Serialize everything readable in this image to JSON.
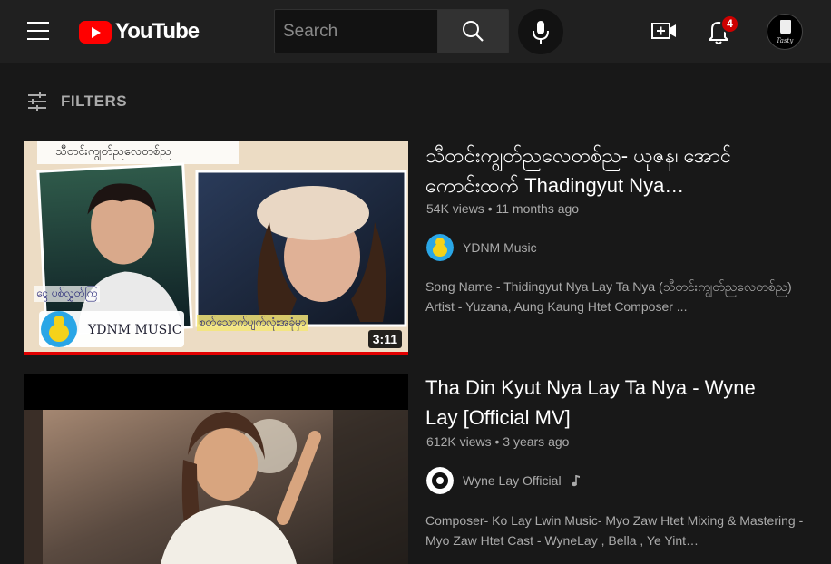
{
  "header": {
    "logo_text": "YouTube",
    "search_placeholder": "Search",
    "notification_count": "4",
    "avatar_text": "Tasty"
  },
  "filters": {
    "label": "FILTERS"
  },
  "videos": [
    {
      "thumb_caption": "သီတင်းကျွတ်ညလေတစ်ည",
      "thumb_left_text": "ငွေ ပစ်လွှတ်ကြ",
      "thumb_right_text": "စတ်သောက်ပျက်လုံးအခုံမှာ",
      "thumb_brand": "YDNM MUSIC",
      "duration": "3:11",
      "title": "သီတင်းကျွတ်ညလေတစ်ည- ယုဇန၊ အောင်ကောင်းထက် Thadingyut Nya…",
      "meta": "54K views • 11 months ago",
      "channel": "YDNM Music",
      "description": "Song Name - Thidingyut Nya Lay Ta Nya (သီတင်းကျွတ်ညလေတစ်ည) Artist - Yuzana, Aung Kaung Htet Composer ..."
    },
    {
      "title": "Tha Din Kyut Nya Lay Ta Nya - Wyne Lay [Official MV]",
      "meta": "612K views • 3 years ago",
      "channel": "Wyne Lay Official",
      "description": "Composer- Ko Lay Lwin Music- Myo Zaw Htet Mixing & Mastering - Myo Zaw Htet Cast - WyneLay , Bella , Ye Yint…"
    }
  ],
  "icons": [
    "menu-icon",
    "search-icon",
    "mic-icon",
    "create-video-icon",
    "bell-icon",
    "filter-icon",
    "music-note-icon"
  ],
  "colors": {
    "brand_red": "#ff0000",
    "badge_red": "#cc0000",
    "progress_red": "#e10000",
    "background": "#181818",
    "header": "#202020"
  }
}
